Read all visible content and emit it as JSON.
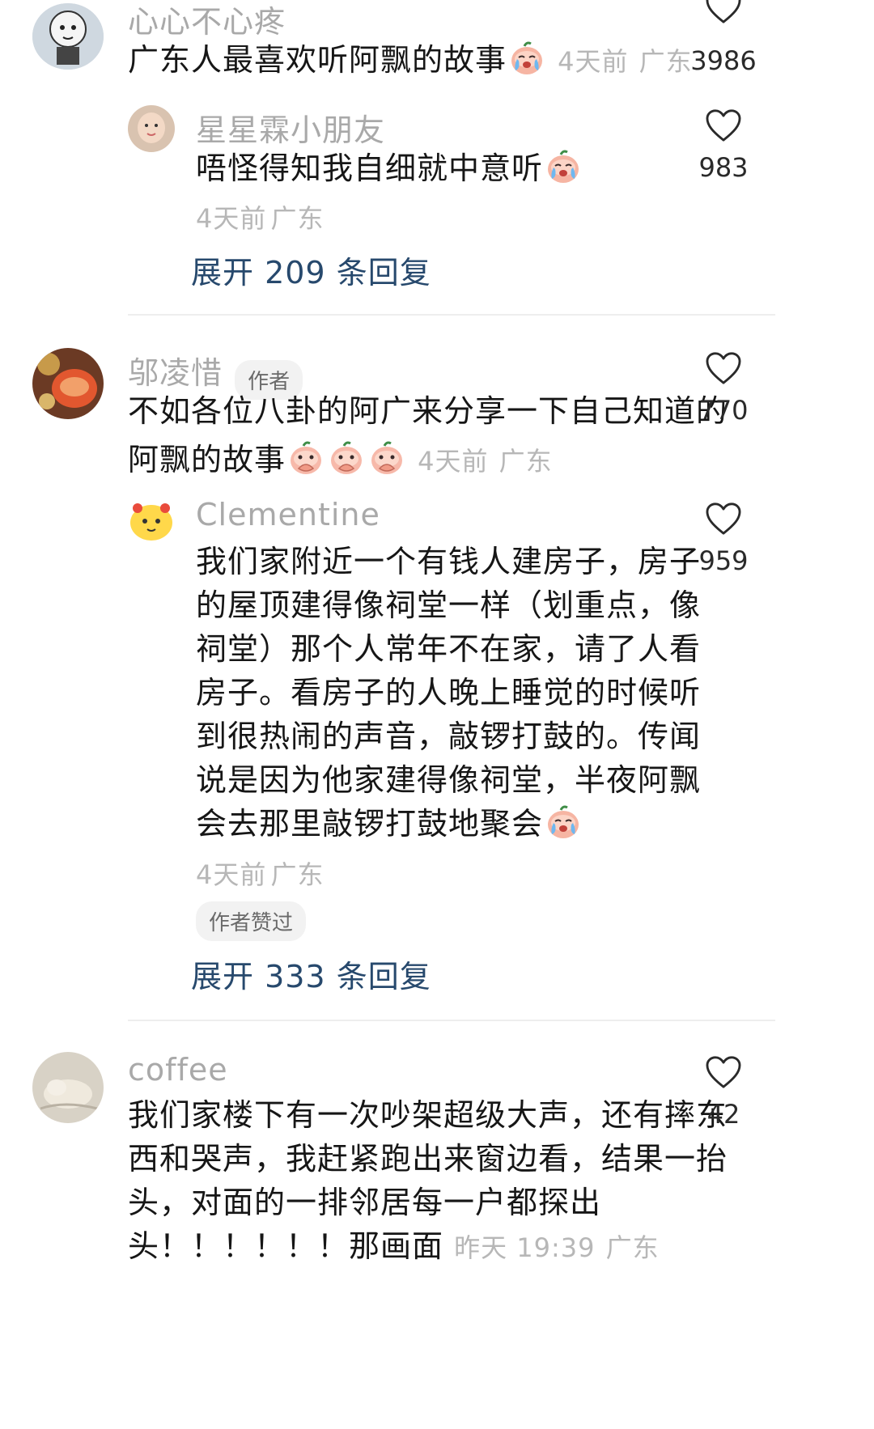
{
  "comments": [
    {
      "username": "心心不心疼",
      "text": "广东人最喜欢听阿飘的故事",
      "time": "4天前",
      "location": "广东",
      "likes": "3986",
      "replies": [
        {
          "username": "星星霖小朋友",
          "text": "唔怪得知我自细就中意听",
          "time": "4天前",
          "location": "广东",
          "likes": "983"
        }
      ],
      "expand_label": "展开 209 条回复"
    },
    {
      "username": "邬凌惜",
      "badge": "作者",
      "text_line1": "不如各位八卦的阿广来分享一下自己知道的",
      "text_line2": "阿飘的故事",
      "time": "4天前",
      "location": "广东",
      "likes": "770",
      "replies": [
        {
          "username": "Clementine",
          "lines": [
            "我们家附近一个有钱人建房子，房子",
            "的屋顶建得像祠堂一样（划重点，像",
            "祠堂）那个人常年不在家，请了人看",
            "房子。看房子的人晚上睡觉的时候听",
            "到很热闹的声音，敲锣打鼓的。传闻",
            "说是因为他家建得像祠堂，半夜阿飘",
            "会去那里敲锣打鼓地聚会"
          ],
          "time": "4天前",
          "location": "广东",
          "author_liked": "作者赞过",
          "likes": "959"
        }
      ],
      "expand_label": "展开 333 条回复"
    },
    {
      "username": "coffee",
      "lines": [
        "我们家楼下有一次吵架超级大声，还有摔东",
        "西和哭声，我赶紧跑出来窗边看，结果一抬",
        "头，对面的一排邻居每一户都探出",
        "头！！！！！！那画面"
      ],
      "time": "昨天 19:39",
      "location": "广东",
      "likes": "42"
    }
  ],
  "colors": {
    "username": "#a9a9a9",
    "meta": "#b7b7b7",
    "expand": "#27496d",
    "divider": "#eeeeee"
  }
}
